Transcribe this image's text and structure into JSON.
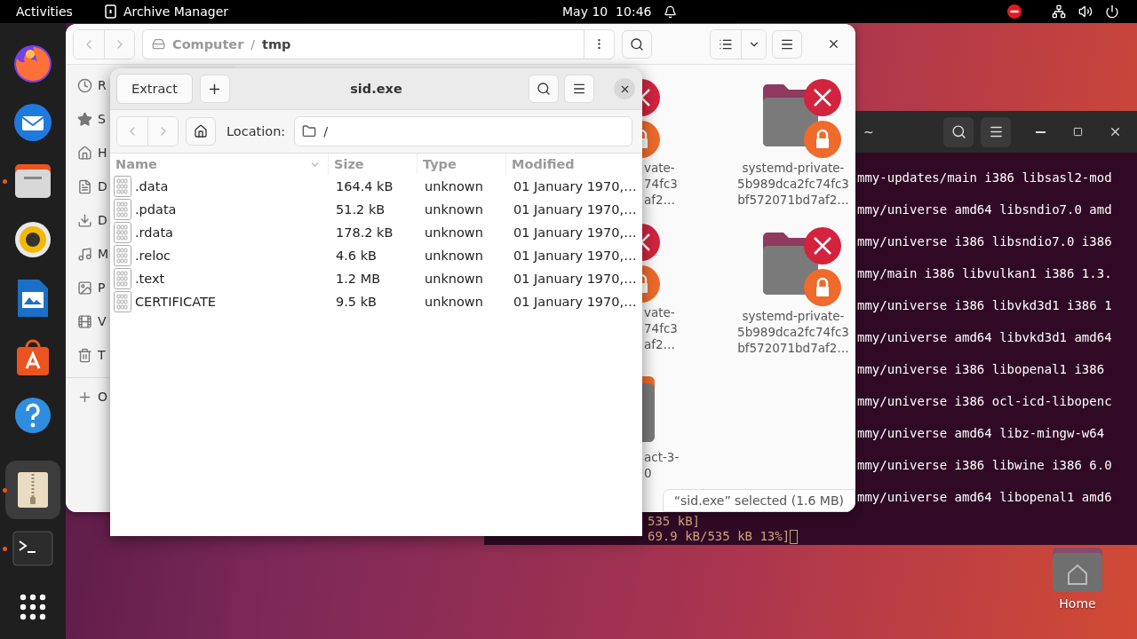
{
  "top_bar": {
    "activities": "Activities",
    "app_name": "Archive Manager",
    "clock": "May 10  10:46"
  },
  "dock": {
    "items": [
      {
        "kind": "firefox",
        "running": false,
        "selected": false
      },
      {
        "kind": "thunderbird",
        "running": false,
        "selected": false
      },
      {
        "kind": "files",
        "running": true,
        "selected": false
      },
      {
        "kind": "rhythmbox",
        "running": false,
        "selected": false
      },
      {
        "kind": "writer",
        "running": false,
        "selected": false
      },
      {
        "kind": "appcenter",
        "running": false,
        "selected": false
      },
      {
        "kind": "help",
        "running": false,
        "selected": false
      }
    ],
    "running_apps": [
      {
        "kind": "archive",
        "running": true,
        "selected": true
      },
      {
        "kind": "terminal",
        "running": true,
        "selected": false
      }
    ]
  },
  "desktop_icons": [
    {
      "label": "Home"
    }
  ],
  "terminal": {
    "title": "~",
    "lines": [
      "mmy-updates/main i386 libsasl2-mod",
      "mmy/universe amd64 libsndio7.0 amd",
      "mmy/universe i386 libsndio7.0 i386",
      "mmy/main i386 libvulkan1 i386 1.3.",
      "mmy/universe i386 libvkd3d1 i386 1",
      "mmy/universe amd64 libvkd3d1 amd64",
      "mmy/universe i386 libopenal1 i386",
      "mmy/universe i386 ocl-icd-libopenc",
      "mmy/universe amd64 libz-mingw-w64",
      "mmy/universe i386 libwine i386 6.0",
      "mmy/universe amd64 libopenal1 amd6"
    ],
    "progress_lines": [
      "535 kB]",
      "69.9 kB/535 kB 13%]"
    ]
  },
  "file_manager": {
    "path": [
      {
        "label": "Computer",
        "separator": "/"
      },
      {
        "label": "tmp"
      }
    ],
    "sidebar": [
      {
        "kind": "recent",
        "label": "R"
      },
      {
        "kind": "starred",
        "label": "S"
      },
      {
        "kind": "home",
        "label": "H"
      },
      {
        "kind": "documents",
        "label": "D"
      },
      {
        "kind": "downloads",
        "label": "D"
      },
      {
        "kind": "music",
        "label": "M"
      },
      {
        "kind": "pictures",
        "label": "P"
      },
      {
        "kind": "videos",
        "label": "V"
      },
      {
        "kind": "trash",
        "label": "T"
      }
    ],
    "other_locations": {
      "label": "O"
    },
    "partial_items": [
      {
        "kind": "locked-folder",
        "lines": [
          "vate-",
          "74fc3",
          "af2…"
        ]
      },
      {
        "kind": "locked-folder",
        "lines": [
          "vate-",
          "74fc3",
          "af2…"
        ]
      },
      {
        "kind": "folder",
        "lines": [
          "act-3-",
          "0"
        ]
      }
    ],
    "items": [
      {
        "kind": "locked-folder",
        "lines": [
          "systemd-private-",
          "5b989dca2fc74fc3",
          "bf572071bd7af2…"
        ]
      },
      {
        "kind": "locked-folder",
        "lines": [
          "systemd-private-",
          "5b989dca2fc74fc3",
          "bf572071bd7af2…"
        ]
      }
    ],
    "status": "“sid.exe” selected (1.6 MB)"
  },
  "archive": {
    "title": "sid.exe",
    "extract": "Extract",
    "location_label": "Location:",
    "location": "/",
    "columns": [
      "Name",
      "Size",
      "Type",
      "Modified"
    ],
    "rows": [
      {
        "name": ".data",
        "size": "164.4 kB",
        "type": "unknown",
        "modified": "01 January 1970,…"
      },
      {
        "name": ".pdata",
        "size": "51.2 kB",
        "type": "unknown",
        "modified": "01 January 1970,…"
      },
      {
        "name": ".rdata",
        "size": "178.2 kB",
        "type": "unknown",
        "modified": "01 January 1970,…"
      },
      {
        "name": ".reloc",
        "size": "4.6 kB",
        "type": "unknown",
        "modified": "01 January 1970,…"
      },
      {
        "name": ".text",
        "size": "1.2 MB",
        "type": "unknown",
        "modified": "01 January 1970,…"
      },
      {
        "name": "CERTIFICATE",
        "size": "9.5 kB",
        "type": "unknown",
        "modified": "01 January 1970,…"
      }
    ]
  }
}
